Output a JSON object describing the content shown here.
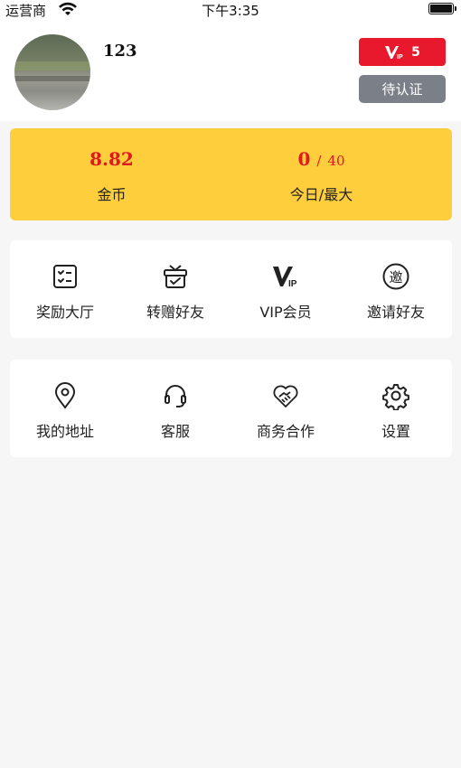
{
  "status_bar": {
    "carrier": "运营商",
    "time": "下午3:35"
  },
  "profile": {
    "username": "123",
    "vip_level": "5",
    "cert_button": "待认证"
  },
  "wallet": {
    "coins_value": "8.82",
    "coins_label": "金币",
    "today_value": "0",
    "today_max": "40",
    "today_separator": "/",
    "today_label": "今日/最大"
  },
  "menu_row1": [
    {
      "label": "奖励大厅",
      "icon": "checklist-icon"
    },
    {
      "label": "转赠好友",
      "icon": "gift-icon"
    },
    {
      "label": "VIP会员",
      "icon": "vip-icon"
    },
    {
      "label": "邀请好友",
      "icon": "invite-icon"
    }
  ],
  "menu_row2": [
    {
      "label": "我的地址",
      "icon": "location-pin-icon"
    },
    {
      "label": "客服",
      "icon": "headset-icon"
    },
    {
      "label": "商务合作",
      "icon": "handshake-heart-icon"
    },
    {
      "label": "设置",
      "icon": "gear-icon"
    }
  ],
  "colors": {
    "vip_badge": "#e8192c",
    "cert_button": "#7b8088",
    "coin_card": "#fece3c",
    "value_red": "#e0181f"
  }
}
